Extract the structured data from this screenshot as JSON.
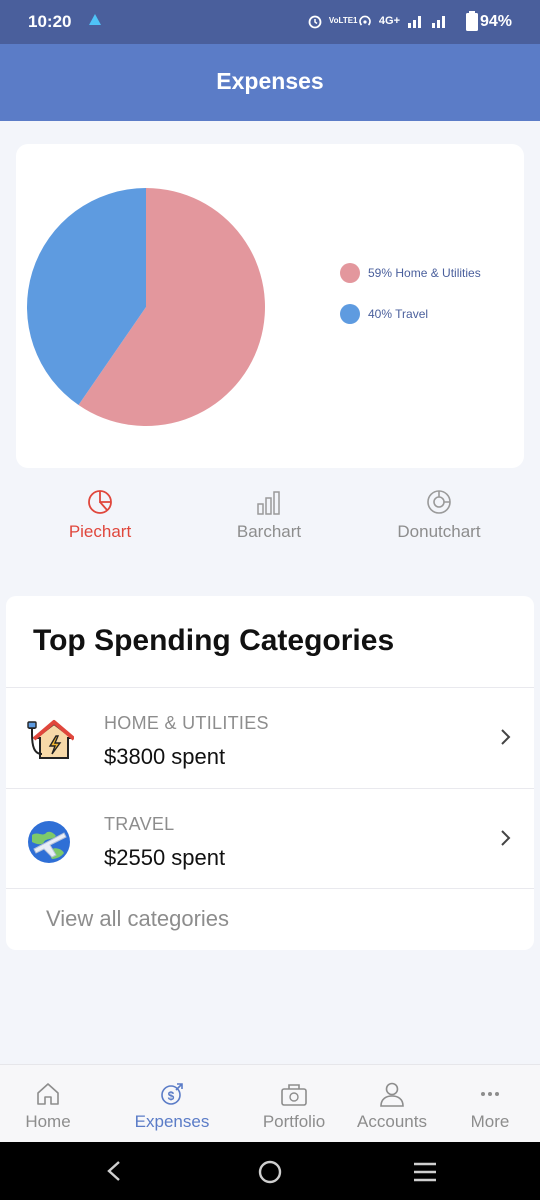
{
  "status_bar": {
    "time": "10:20",
    "network": "4G+",
    "lte": "VoLTE1",
    "battery": "94%"
  },
  "app_bar": {
    "title": "Expenses"
  },
  "chart": {
    "type": "pie",
    "legend": [
      "59% Home & Utilities",
      "40% Travel"
    ],
    "colors": [
      "#e3979d",
      "#5e9be0"
    ],
    "tabs": [
      {
        "label": "Piechart",
        "icon": "piechart-icon",
        "active": true
      },
      {
        "label": "Barchart",
        "icon": "barchart-icon",
        "active": false
      },
      {
        "label": "Donutchart",
        "icon": "donutchart-icon",
        "active": false
      }
    ]
  },
  "chart_data": {
    "type": "pie",
    "categories": [
      "Home & Utilities",
      "Travel"
    ],
    "values": [
      59,
      40
    ],
    "colors": [
      "#e3979d",
      "#5e9be0"
    ]
  },
  "top_spending": {
    "title": "Top Spending Categories",
    "categories": [
      {
        "name": "HOME & UTILITIES",
        "amount": "$3800 spent",
        "icon": "home-utilities-icon"
      },
      {
        "name": "TRAVEL",
        "amount": "$2550 spent",
        "icon": "travel-icon"
      }
    ],
    "view_all": "View all categories"
  },
  "bottom_nav": [
    {
      "label": "Home",
      "icon": "home-icon",
      "active": false
    },
    {
      "label": "Expenses",
      "icon": "expenses-icon",
      "active": true
    },
    {
      "label": "Portfolio",
      "icon": "portfolio-icon",
      "active": false
    },
    {
      "label": "Accounts",
      "icon": "accounts-icon",
      "active": false
    },
    {
      "label": "More",
      "icon": "more-icon",
      "active": false
    }
  ]
}
